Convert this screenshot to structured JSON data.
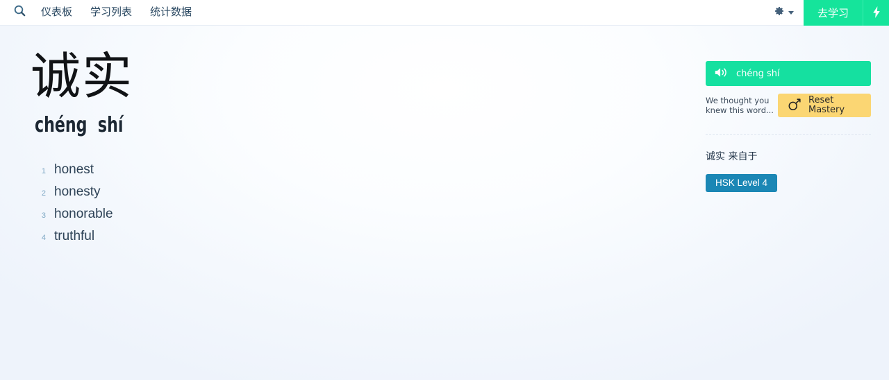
{
  "header": {
    "search_icon": "search-icon",
    "nav_items": [
      {
        "label": "仪表板"
      },
      {
        "label": "学习列表"
      },
      {
        "label": "统计数据"
      }
    ],
    "settings_icon": "gear-icon",
    "study_button": "去学习",
    "bolt_icon": "lightning-bolt-icon"
  },
  "word": {
    "hanzi": "诚实",
    "pinyin": "chéng  shí",
    "definitions": [
      {
        "num": "1",
        "text": "honest"
      },
      {
        "num": "2",
        "text": "honesty"
      },
      {
        "num": "3",
        "text": "honorable"
      },
      {
        "num": "4",
        "text": "truthful"
      }
    ]
  },
  "sidebar": {
    "audio_label": "chéng shí",
    "audio_icon": "speaker-icon",
    "mastery_note": "We thought you knew this word...",
    "reset_icon": "reset-mastery-icon",
    "reset_label_line1": "Reset",
    "reset_label_line2": "Mastery",
    "origin_text": "诚实 来自于",
    "hsk_badge": "HSK Level 4"
  },
  "colors": {
    "accent_green": "#15e49b",
    "audio_green": "#15e0a0",
    "reset_yellow": "#fbd673",
    "hsk_blue": "#1b87b5",
    "nav_text": "#2c4a63",
    "def_text": "#2d4256",
    "def_num": "#7ea8c4",
    "background": "#f2f6fc"
  }
}
